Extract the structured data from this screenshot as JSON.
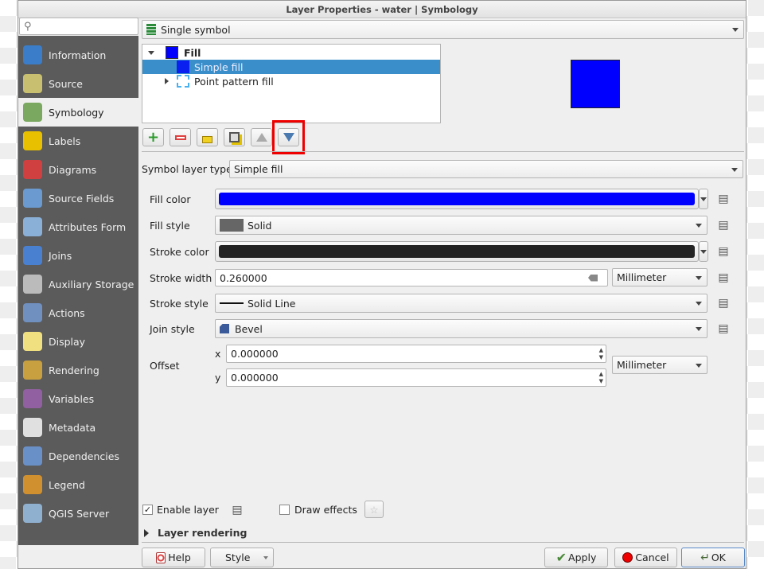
{
  "window": {
    "title": "Layer Properties - water | Symbology"
  },
  "search": {
    "placeholder": ""
  },
  "sidebar": {
    "items": [
      {
        "label": "Information",
        "icon": "info-icon",
        "color": "#3b7dc8"
      },
      {
        "label": "Source",
        "icon": "wrench-gear-icon",
        "color": "#c8c070"
      },
      {
        "label": "Symbology",
        "icon": "paintbrush-icon",
        "color": "#7aa860"
      },
      {
        "label": "Labels",
        "icon": "abc-label-icon",
        "color": "#e8c000"
      },
      {
        "label": "Diagrams",
        "icon": "diagram-icon",
        "color": "#d04040"
      },
      {
        "label": "Source Fields",
        "icon": "fields-icon",
        "color": "#6a9ad0"
      },
      {
        "label": "Attributes Form",
        "icon": "form-icon",
        "color": "#8ab0d8"
      },
      {
        "label": "Joins",
        "icon": "joins-icon",
        "color": "#4a80d0"
      },
      {
        "label": "Auxiliary Storage",
        "icon": "database-icon",
        "color": "#bbbbbb"
      },
      {
        "label": "Actions",
        "icon": "actions-gear-icon",
        "color": "#7090c0"
      },
      {
        "label": "Display",
        "icon": "speech-bubble-icon",
        "color": "#f0e080"
      },
      {
        "label": "Rendering",
        "icon": "brush-icon",
        "color": "#c8a040"
      },
      {
        "label": "Variables",
        "icon": "epsilon-icon",
        "color": "#9060a0"
      },
      {
        "label": "Metadata",
        "icon": "metadata-icon",
        "color": "#e0e0e0"
      },
      {
        "label": "Dependencies",
        "icon": "dependencies-icon",
        "color": "#6a90c8"
      },
      {
        "label": "Legend",
        "icon": "legend-icon",
        "color": "#d09030"
      },
      {
        "label": "QGIS Server",
        "icon": "server-icon",
        "color": "#90b0d0"
      }
    ],
    "selected": "Symbology"
  },
  "renderer": {
    "value": "Single symbol"
  },
  "tree": {
    "root": "Fill",
    "items": [
      {
        "label": "Simple fill",
        "selected": true
      },
      {
        "label": "Point pattern fill",
        "selected": false
      }
    ]
  },
  "symbol_color": "#0000ff",
  "layer_type": {
    "label": "Symbol layer type",
    "value": "Simple fill"
  },
  "form": {
    "fill_color": {
      "label": "Fill color",
      "color": "#0000ff"
    },
    "fill_style": {
      "label": "Fill style",
      "value": "Solid"
    },
    "stroke_color": {
      "label": "Stroke color",
      "color": "#232323"
    },
    "stroke_width": {
      "label": "Stroke width",
      "value": "0.260000",
      "unit": "Millimeter"
    },
    "stroke_style": {
      "label": "Stroke style",
      "value": "Solid Line"
    },
    "join_style": {
      "label": "Join style",
      "value": "Bevel"
    },
    "offset": {
      "label": "Offset",
      "x_label": "x",
      "y_label": "y",
      "x": "0.000000",
      "y": "0.000000",
      "unit": "Millimeter"
    }
  },
  "enable_layer": {
    "label": "Enable layer",
    "checked": true
  },
  "draw_effects": {
    "label": "Draw effects",
    "checked": false
  },
  "layer_rendering": {
    "label": "Layer rendering"
  },
  "buttons": {
    "help": "Help",
    "style": "Style",
    "apply": "Apply",
    "cancel": "Cancel",
    "ok": "OK"
  }
}
